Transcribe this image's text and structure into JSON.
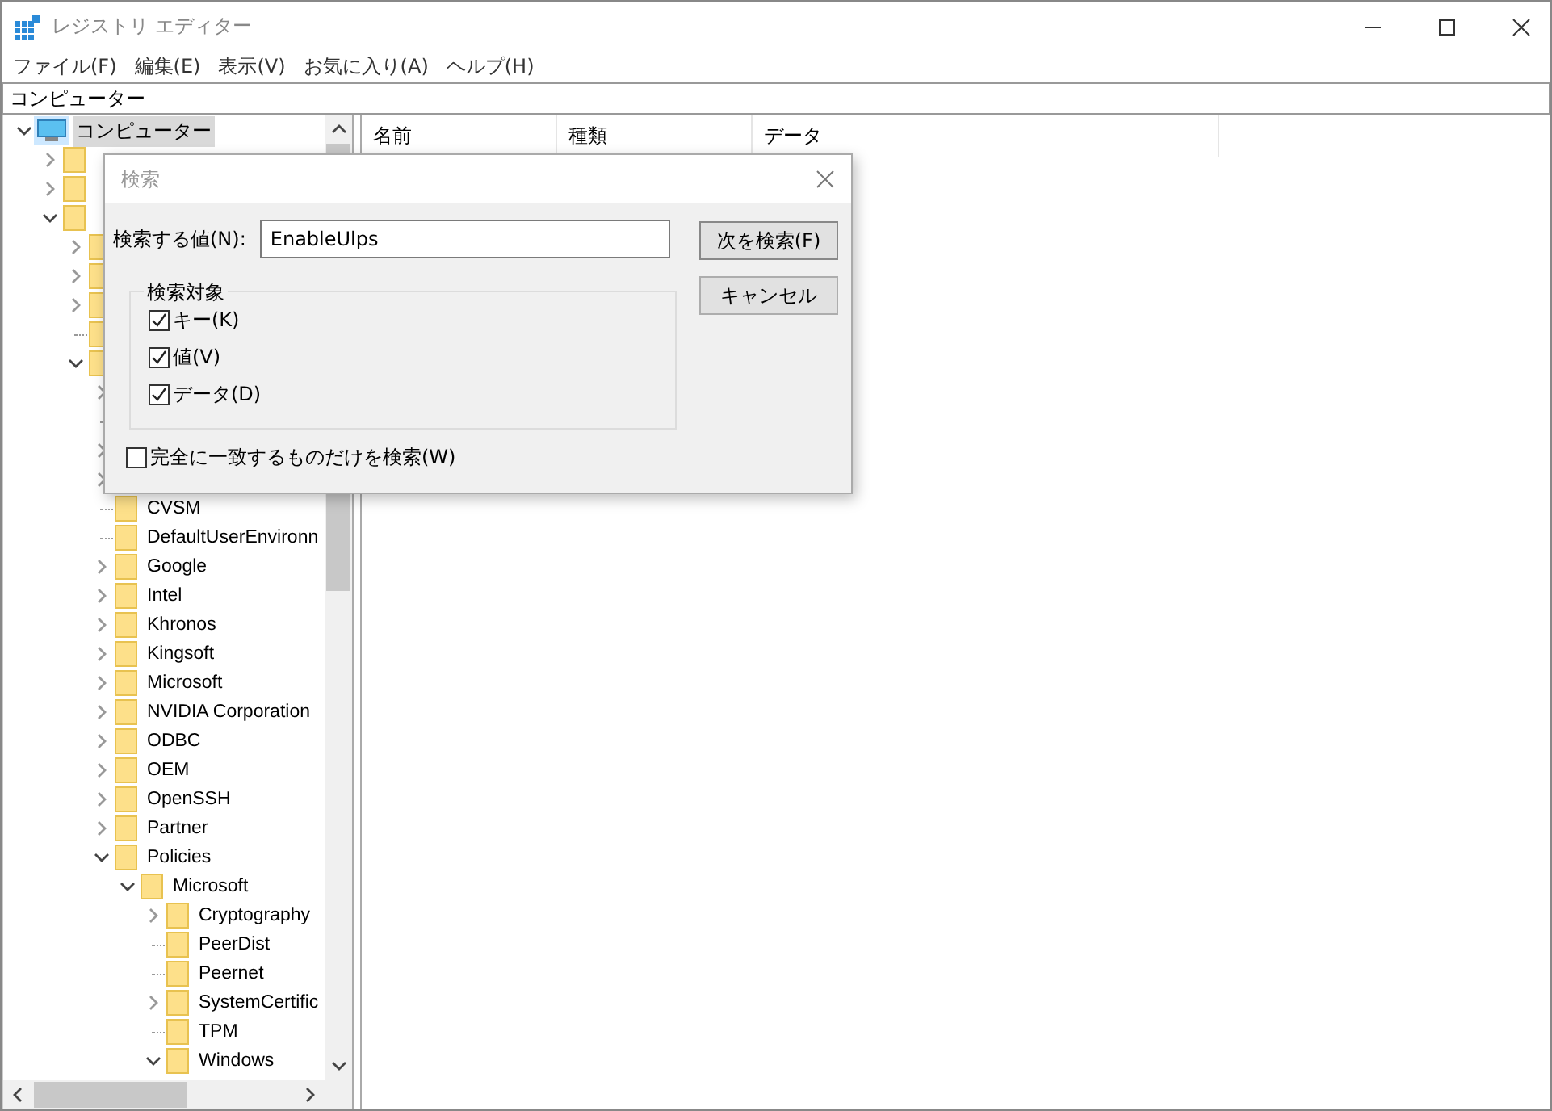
{
  "window": {
    "title": "レジストリ エディター"
  },
  "menu": [
    "ファイル(F)",
    "編集(E)",
    "表示(V)",
    "お気に入り(A)",
    "ヘルプ(H)"
  ],
  "address": "コンピューター",
  "tree": {
    "items": [
      {
        "label": "コンピューター",
        "kind": "computer",
        "expanded": true,
        "selected": true,
        "children": [
          {
            "kind": "folder",
            "expanded": false,
            "selected": false
          },
          {
            "kind": "folder",
            "expanded": false,
            "selected": false
          },
          {
            "kind": "folder",
            "expanded": true,
            "selected": false,
            "children": [
              {
                "kind": "folder",
                "expanded": false,
                "selected": false
              },
              {
                "kind": "folder",
                "expanded": false,
                "selected": false
              },
              {
                "kind": "folder",
                "expanded": false,
                "selected": false
              },
              {
                "kind": "folder",
                "selected": false
              },
              {
                "kind": "folder",
                "expanded": true,
                "selected": false,
                "children": [
                  {
                    "expanded": false,
                    "selected": false
                  },
                  {
                    "selected": false
                  },
                  {
                    "expanded": false,
                    "selected": false
                  },
                  {
                    "expanded": false,
                    "selected": false
                  },
                  {
                    "label": "CVSM",
                    "kind": "folder",
                    "selected": false
                  },
                  {
                    "label": "DefaultUserEnvironn",
                    "kind": "folder",
                    "selected": false
                  },
                  {
                    "label": "Google",
                    "kind": "folder",
                    "expanded": false,
                    "selected": false
                  },
                  {
                    "label": "Intel",
                    "kind": "folder",
                    "expanded": false,
                    "selected": false
                  },
                  {
                    "label": "Khronos",
                    "kind": "folder",
                    "expanded": false,
                    "selected": false
                  },
                  {
                    "label": "Kingsoft",
                    "kind": "folder",
                    "expanded": false,
                    "selected": false
                  },
                  {
                    "label": "Microsoft",
                    "kind": "folder",
                    "expanded": false,
                    "selected": false
                  },
                  {
                    "label": "NVIDIA Corporation",
                    "kind": "folder",
                    "expanded": false,
                    "selected": false
                  },
                  {
                    "label": "ODBC",
                    "kind": "folder",
                    "expanded": false,
                    "selected": false
                  },
                  {
                    "label": "OEM",
                    "kind": "folder",
                    "expanded": false,
                    "selected": false
                  },
                  {
                    "label": "OpenSSH",
                    "kind": "folder",
                    "expanded": false,
                    "selected": false
                  },
                  {
                    "label": "Partner",
                    "kind": "folder",
                    "expanded": false,
                    "selected": false
                  },
                  {
                    "label": "Policies",
                    "kind": "folder",
                    "expanded": true,
                    "selected": false,
                    "children": [
                      {
                        "label": "Microsoft",
                        "kind": "folder",
                        "expanded": true,
                        "selected": false,
                        "children": [
                          {
                            "label": "Cryptography",
                            "kind": "folder",
                            "expanded": false,
                            "selected": false
                          },
                          {
                            "label": "PeerDist",
                            "kind": "folder",
                            "selected": false
                          },
                          {
                            "label": "Peernet",
                            "kind": "folder",
                            "selected": false
                          },
                          {
                            "label": "SystemCertific",
                            "kind": "folder",
                            "expanded": false,
                            "selected": false
                          },
                          {
                            "label": "TPM",
                            "kind": "folder",
                            "selected": false
                          },
                          {
                            "label": "Windows",
                            "kind": "folder",
                            "expanded": true,
                            "selected": false
                          }
                        ]
                      }
                    ]
                  }
                ]
              }
            ]
          }
        ]
      }
    ]
  },
  "columns": [
    "名前",
    "種類",
    "データ"
  ],
  "dialog": {
    "title": "検索",
    "find_label": "検索する値(N):",
    "find_value": "EnableUlps",
    "buttons": [
      "次を検索(F)",
      "キャンセル"
    ],
    "group_label": "検索対象",
    "options": [
      {
        "label": "キー(K)",
        "checked": true
      },
      {
        "label": "値(V)",
        "checked": true
      },
      {
        "label": "データ(D)",
        "checked": true
      }
    ],
    "whole_match": {
      "label": "完全に一致するものだけを検索(W)",
      "checked": false
    }
  }
}
